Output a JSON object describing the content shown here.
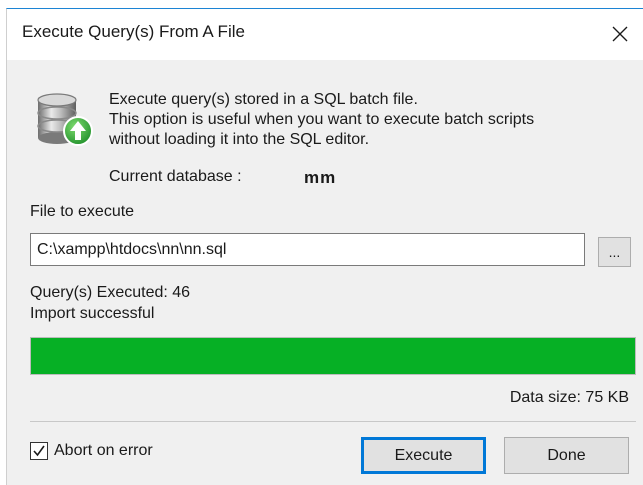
{
  "window": {
    "title": "Execute Query(s) From A File",
    "close_icon": "close-icon"
  },
  "info": {
    "icon": "database-upload-icon",
    "lines": [
      "Execute query(s) stored in a SQL batch file.",
      "This option is useful when you want to execute batch scripts",
      "without loading it into the SQL editor."
    ],
    "current_database_label": "Current database :",
    "current_database_value": "mm"
  },
  "file": {
    "label": "File to execute",
    "value": "C:\\xampp\\htdocs\\nn\\nn.sql",
    "browse_label": "..."
  },
  "status": {
    "queries_executed": "Query(s) Executed: 46",
    "result": "Import successful"
  },
  "progress": {
    "percent": 100,
    "color": "#06b025"
  },
  "data_size": "Data size: 75 KB",
  "options": {
    "abort_on_error_label": "Abort on error",
    "abort_on_error_checked": true
  },
  "buttons": {
    "execute_label": "Execute",
    "done_label": "Done"
  },
  "colors": {
    "accent": "#0078d7",
    "title_border": "#1c84d4",
    "progress_green": "#06b025",
    "icon_arrow_green": "#3aa63a"
  }
}
